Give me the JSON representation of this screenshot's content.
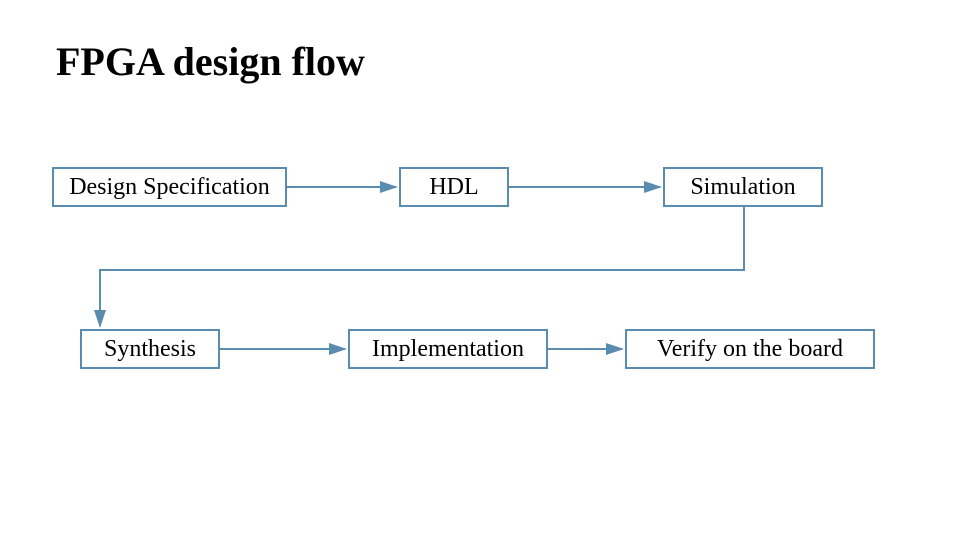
{
  "title": "FPGA design flow",
  "nodes": {
    "design_spec": "Design Specification",
    "hdl": "HDL",
    "simulation": "Simulation",
    "synthesis": "Synthesis",
    "implementation": "Implementation",
    "verify": "Verify on the board"
  }
}
